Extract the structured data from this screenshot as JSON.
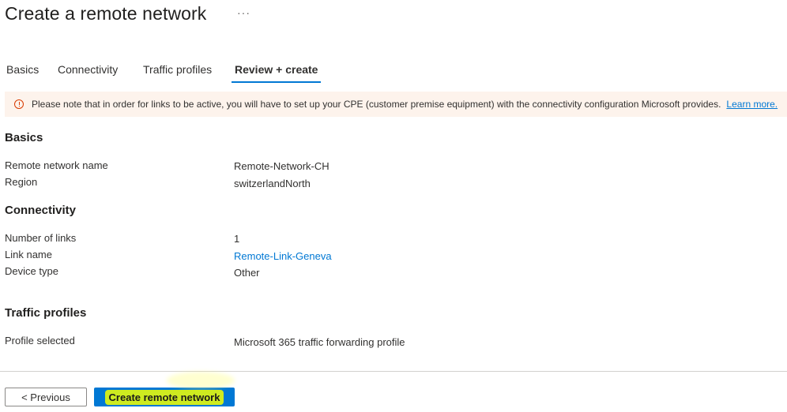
{
  "header": {
    "title": "Create a remote network",
    "more_icon": "ellipsis-icon",
    "more_label": "···"
  },
  "tabs": [
    {
      "label": "Basics",
      "active": false
    },
    {
      "label": "Connectivity",
      "active": false
    },
    {
      "label": "Traffic profiles",
      "active": false
    },
    {
      "label": "Review + create",
      "active": true
    }
  ],
  "banner": {
    "icon": "info-circle-icon",
    "message": "Please note that in order for links to be active, you will have to set up your CPE (customer premise equipment) with the connectivity configuration Microsoft provides.",
    "link": "Learn more."
  },
  "basics": {
    "heading": "Basics",
    "rows": [
      {
        "label": "Remote network name",
        "value": "Remote-Network-CH"
      },
      {
        "label": "Region",
        "value": "switzerlandNorth"
      }
    ]
  },
  "connectivity": {
    "heading": "Connectivity",
    "rows": [
      {
        "label": "Number of links",
        "value": "1"
      },
      {
        "label": "Link name",
        "value": "Remote-Link-Geneva"
      },
      {
        "label": "Device type",
        "value": "Other"
      }
    ]
  },
  "traffic": {
    "heading": "Traffic profiles",
    "rows": [
      {
        "label": "Profile selected",
        "value": "Microsoft 365 traffic forwarding profile"
      }
    ]
  },
  "footer": {
    "previous_label": "< Previous",
    "create_label": "Create remote network"
  },
  "colors": {
    "accent": "#0078d4",
    "banner_bg": "#fdf3ec",
    "warning": "#d83b01",
    "highlight": "#f2ff00"
  }
}
